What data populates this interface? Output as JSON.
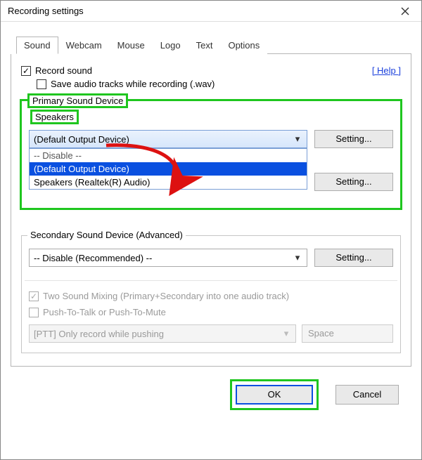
{
  "window": {
    "title": "Recording settings"
  },
  "tabs": [
    "Sound",
    "Webcam",
    "Mouse",
    "Logo",
    "Text",
    "Options"
  ],
  "active_tab": "Sound",
  "help_label": "[ Help ]",
  "checkboxes": {
    "record_sound": {
      "label": "Record sound",
      "checked": true
    },
    "save_wav": {
      "label": "Save audio tracks while recording (.wav)",
      "checked": false
    },
    "two_sound": {
      "label": "Two Sound Mixing (Primary+Secondary into one audio track)",
      "checked": true,
      "disabled": true
    },
    "ptt": {
      "label": "Push-To-Talk or Push-To-Mute",
      "checked": false,
      "disabled": true
    }
  },
  "primary": {
    "legend": "Primary Sound Device",
    "speakers_label": "Speakers",
    "selected": "(Default Output Device)",
    "options": [
      "-- Disable --",
      "(Default Output Device)",
      "Speakers (Realtek(R) Audio)"
    ],
    "highlighted_option": "(Default Output Device)",
    "setting_label": "Setting..."
  },
  "secondary": {
    "legend": "Secondary Sound Device (Advanced)",
    "selected": "-- Disable (Recommended) --",
    "setting_label": "Setting..."
  },
  "ptt_section": {
    "dd_label": "[PTT] Only record while pushing",
    "key": "Space"
  },
  "buttons": {
    "ok": "OK",
    "cancel": "Cancel",
    "setting": "Setting..."
  }
}
